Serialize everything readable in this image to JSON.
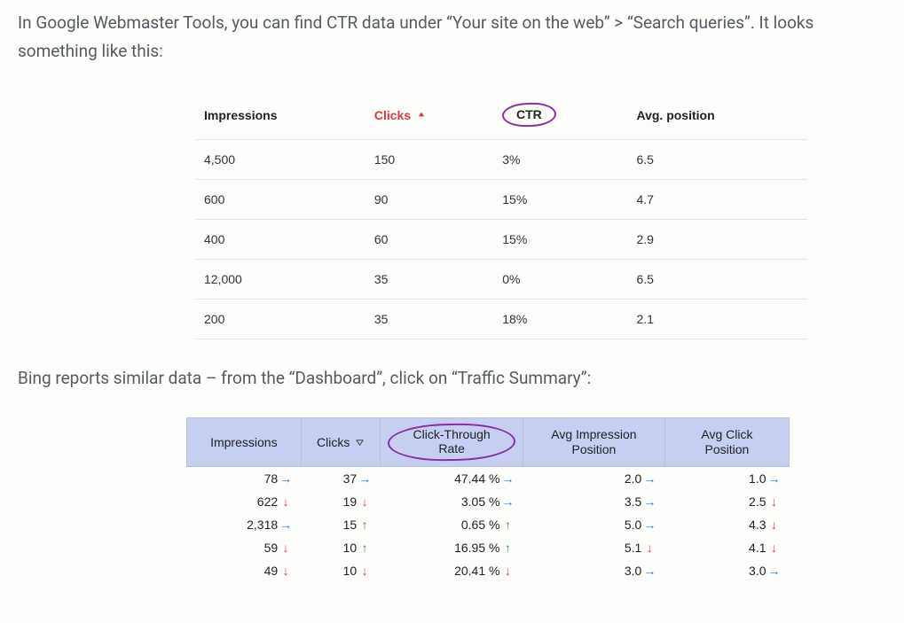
{
  "para1": "In Google Webmaster Tools, you can find CTR data under “Your site on the web” > “Search queries”. It looks something like this:",
  "para2": "Bing reports similar data – from the “Dashboard”, click on “Traffic Summary”:",
  "google": {
    "headers": {
      "impressions": "Impressions",
      "clicks": "Clicks",
      "ctr": "CTR",
      "avg_position": "Avg. position"
    },
    "rows": [
      {
        "impressions": "4,500",
        "clicks": "150",
        "ctr": "3%",
        "avg": "6.5"
      },
      {
        "impressions": "600",
        "clicks": "90",
        "ctr": "15%",
        "avg": "4.7"
      },
      {
        "impressions": "400",
        "clicks": "60",
        "ctr": "15%",
        "avg": "2.9"
      },
      {
        "impressions": "12,000",
        "clicks": "35",
        "ctr": "0%",
        "avg": "6.5"
      },
      {
        "impressions": "200",
        "clicks": "35",
        "ctr": "18%",
        "avg": "2.1"
      }
    ]
  },
  "bing": {
    "headers": {
      "impressions": "Impressions",
      "clicks": "Clicks",
      "ctr_l1": "Click-Through",
      "ctr_l2": "Rate",
      "aip_l1": "Avg Impression",
      "aip_l2": "Position",
      "acp_l1": "Avg Click",
      "acp_l2": "Position"
    },
    "rows": [
      {
        "impressions": "78",
        "i_dir": "right",
        "clicks": "37",
        "c_dir": "right",
        "ctr": "47.44 %",
        "ctr_dir": "right",
        "aip": "2.0",
        "aip_dir": "right",
        "acp": "1.0",
        "acp_dir": "right"
      },
      {
        "impressions": "622",
        "i_dir": "down",
        "clicks": "19",
        "c_dir": "down",
        "ctr": "3.05 %",
        "ctr_dir": "right",
        "aip": "3.5",
        "aip_dir": "right",
        "acp": "2.5",
        "acp_dir": "down"
      },
      {
        "impressions": "2,318",
        "i_dir": "right",
        "clicks": "15",
        "c_dir": "up",
        "ctr": "0.65 %",
        "ctr_dir": "up",
        "aip": "5.0",
        "aip_dir": "right",
        "acp": "4.3",
        "acp_dir": "down"
      },
      {
        "impressions": "59",
        "i_dir": "down",
        "clicks": "10",
        "c_dir": "up",
        "ctr": "16.95 %",
        "ctr_dir": "up",
        "aip": "5.1",
        "aip_dir": "down",
        "acp": "4.1",
        "acp_dir": "down"
      },
      {
        "impressions": "49",
        "i_dir": "down",
        "clicks": "10",
        "c_dir": "down",
        "ctr": "20.41 %",
        "ctr_dir": "down",
        "aip": "3.0",
        "aip_dir": "right",
        "acp": "3.0",
        "acp_dir": "right"
      }
    ]
  }
}
